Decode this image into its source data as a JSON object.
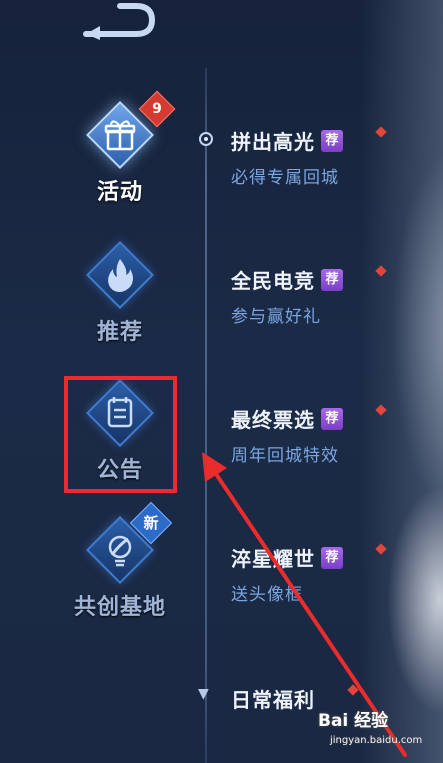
{
  "sidebar": {
    "items": [
      {
        "label": "活动",
        "icon": "gift-icon",
        "badge": "9",
        "active": true
      },
      {
        "label": "推荐",
        "icon": "flame-icon",
        "active": false
      },
      {
        "label": "公告",
        "icon": "notice-icon",
        "active": false
      },
      {
        "label": "共创基地",
        "icon": "lightbulb-icon",
        "badge": "新",
        "active": false
      }
    ]
  },
  "events": [
    {
      "title": "拼出高光",
      "tag": "荐",
      "subtitle": "必得专属回城"
    },
    {
      "title": "全民电竞",
      "tag": "荐",
      "subtitle": "参与赢好礼"
    },
    {
      "title": "最终票选",
      "tag": "荐",
      "subtitle": "周年回城特效"
    },
    {
      "title": "淬星耀世",
      "tag": "荐",
      "subtitle": "送头像框"
    }
  ],
  "section": {
    "title": "日常福利"
  },
  "watermark": {
    "main": "Bai 经验",
    "sub": "jingyan.baidu.com"
  },
  "colors": {
    "background": "#1b2a46",
    "accent_blue": "#3f7bd0",
    "tag_purple": "#9b55dc",
    "highlight_red": "#ea2c2c",
    "subtitle_blue": "#7aa6e0"
  }
}
